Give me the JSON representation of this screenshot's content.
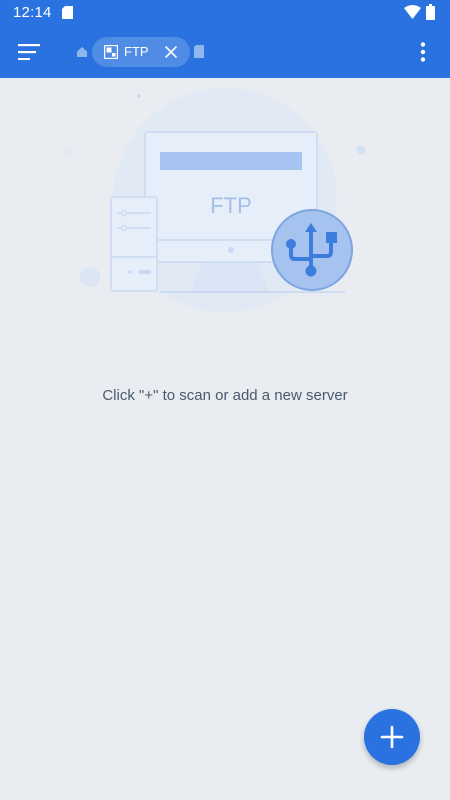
{
  "status_bar": {
    "time": "12:14",
    "icons": [
      "sim-card-icon",
      "wifi-icon",
      "battery-icon"
    ]
  },
  "toolbar": {
    "menu_icon": "menu-icon",
    "breadcrumb": {
      "home_icon": "home-icon",
      "active_tab": {
        "label": "FTP",
        "icon": "ftp-tab-icon",
        "close_icon": "close-icon"
      },
      "next_icon": "folder-crumb-icon"
    },
    "more_icon": "more-vertical-icon"
  },
  "empty_state": {
    "illustration_text": "FTP",
    "message": "Click \"+\" to scan or add a new server"
  },
  "fab": {
    "icon": "plus-icon"
  },
  "colors": {
    "primary": "#2a72e0",
    "background": "#e9edf2",
    "message_text": "#4b5a6b",
    "illustration_light": "#d6e3f6",
    "illustration_accent": "#a7c3ef"
  }
}
